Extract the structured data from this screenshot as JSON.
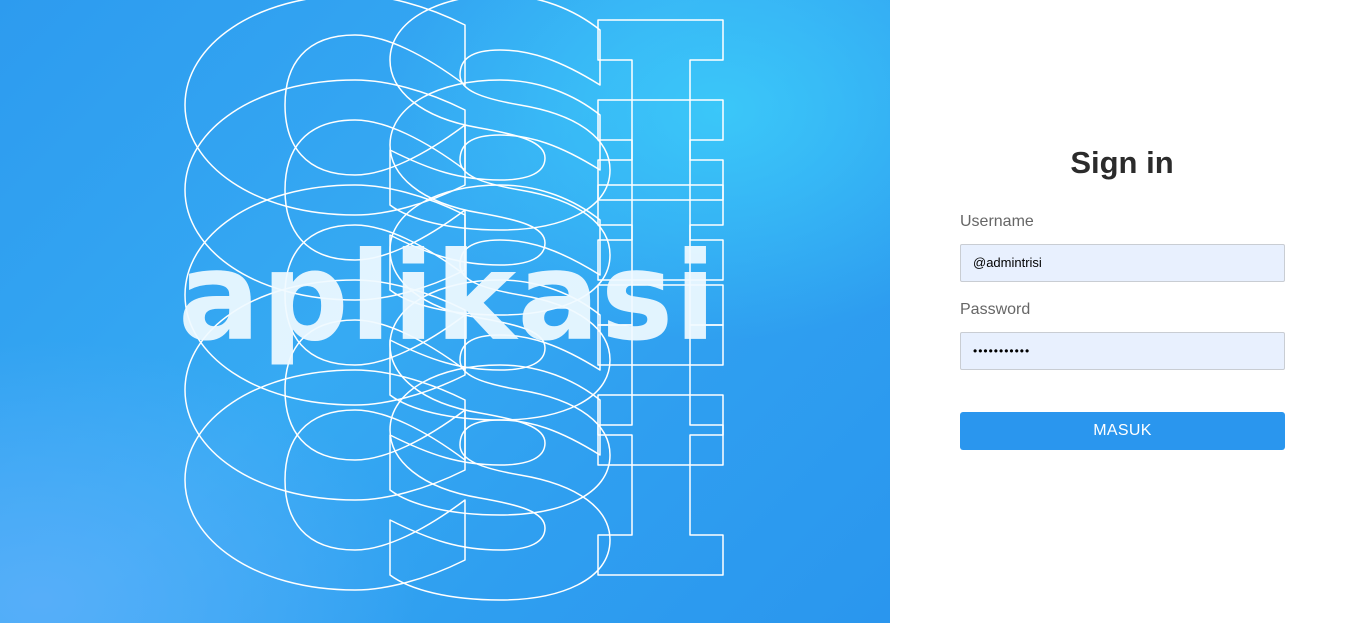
{
  "hero": {
    "background_letters": "CSI",
    "word": "aplikasi",
    "accent_color": "#2f9ff0"
  },
  "signin": {
    "title": "Sign in",
    "username_label": "Username",
    "username_value": "@admintrisi",
    "password_label": "Password",
    "password_masked": "•••••••••••",
    "submit_label": "MASUK",
    "button_color": "#2a96ee"
  }
}
